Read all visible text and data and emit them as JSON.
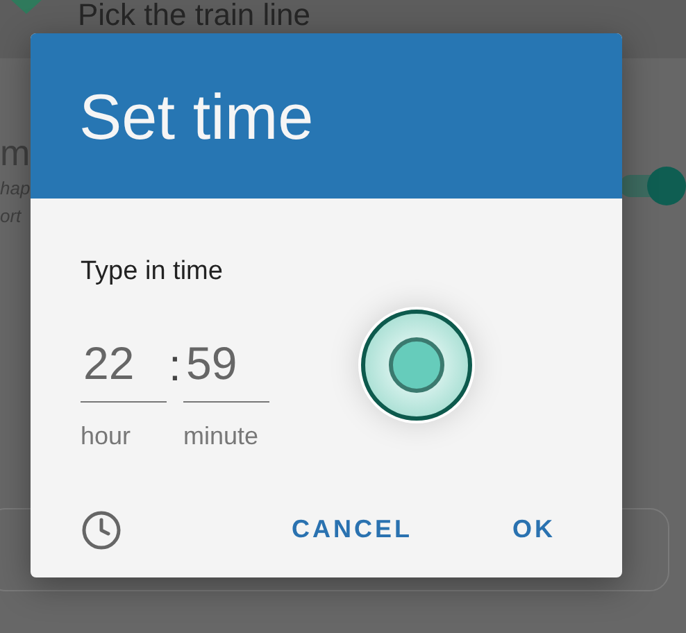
{
  "background": {
    "top_bar": {
      "title": "Pick the train line"
    },
    "fragments": [
      {
        "text": "m",
        "kind": "title"
      },
      {
        "text": "hap",
        "kind": "subtitle"
      },
      {
        "text": "ort",
        "kind": "subtitle"
      }
    ],
    "toggle": {
      "on": true
    }
  },
  "dialog": {
    "title": "Set time",
    "prompt": "Type in time",
    "hour": {
      "value": "22",
      "label": "hour"
    },
    "separator": ":",
    "minute": {
      "value": "59",
      "label": "minute"
    },
    "buttons": [
      "CANCEL",
      "OK"
    ]
  }
}
